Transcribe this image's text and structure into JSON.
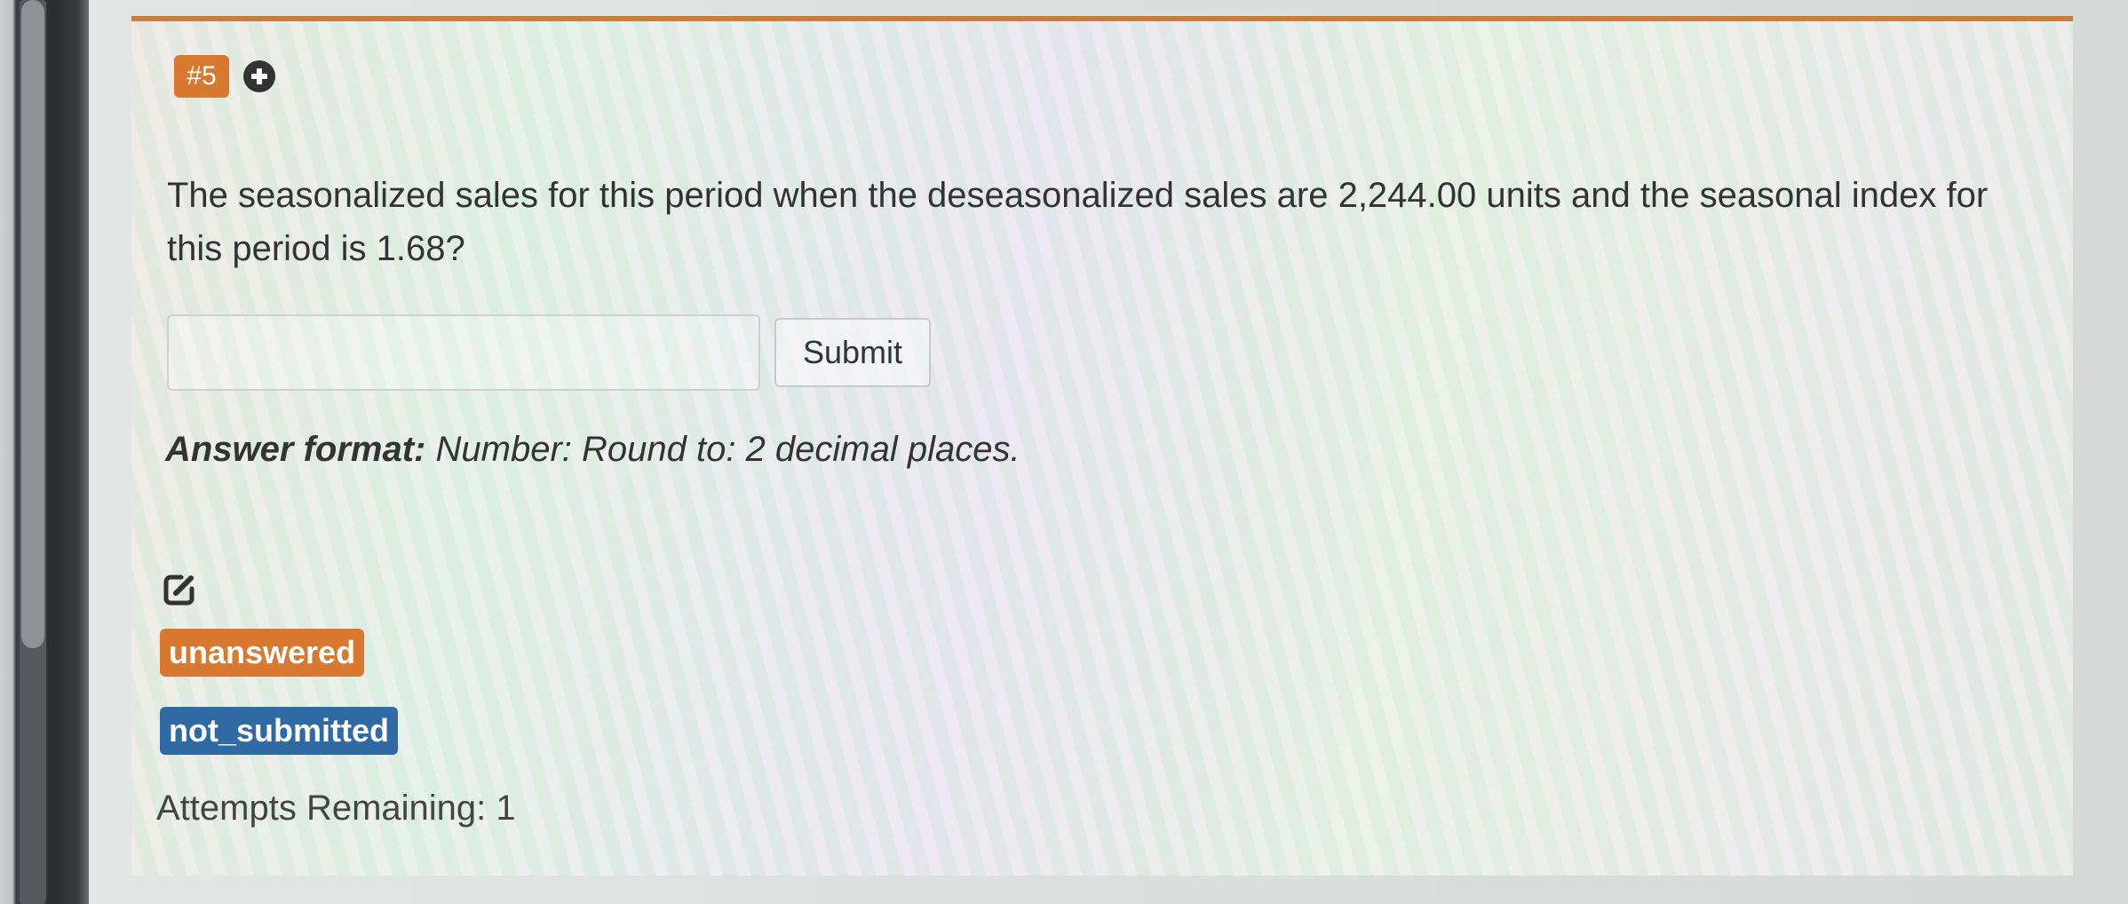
{
  "question": {
    "number_badge": "#5",
    "text": "The seasonalized sales for this period when the deseasonalized sales are 2,244.00 units and the seasonal index for this period is 1.68?"
  },
  "answer": {
    "value": "",
    "submit_label": "Submit",
    "format_label": "Answer format:",
    "format_text": " Number: Round to: 2 decimal places."
  },
  "status": {
    "badge_1": "unanswered",
    "badge_2": "not_submitted",
    "attempts": "Attempts Remaining: 1"
  },
  "colors": {
    "accent_orange": "#d9782f",
    "accent_blue": "#2f6aa5"
  },
  "icons": {
    "add": "plus-circle-icon",
    "edit": "edit-icon"
  }
}
